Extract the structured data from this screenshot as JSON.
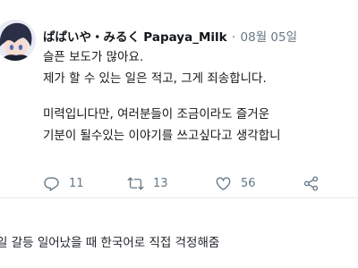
{
  "tweet": {
    "display_name": "ぱぱいや・みるく",
    "handle": "Papaya_Milk",
    "separator": "·",
    "date": "08월 05일",
    "lines": [
      "슬픈 보도가 많아요.",
      "제가 할 수 있는 일은 적고, 그게 죄송합니다.",
      "",
      "미력입니다만, 여러분들이 조금이라도 즐거운",
      "기분이 될수있는 이야기를 쓰고싶다고 생각합니"
    ],
    "actions": {
      "reply_icon": "reply-icon",
      "reply_count": "11",
      "retweet_icon": "retweet-icon",
      "retweet_count": "13",
      "like_icon": "heart-icon",
      "like_count": "56",
      "share_icon": "share-icon"
    }
  },
  "caption": "일 갈등 일어났을 때 한국어로 직접 걱정해줌",
  "colors": {
    "text": "#14171a",
    "muted": "#657786",
    "divider": "#e6ecf0"
  }
}
